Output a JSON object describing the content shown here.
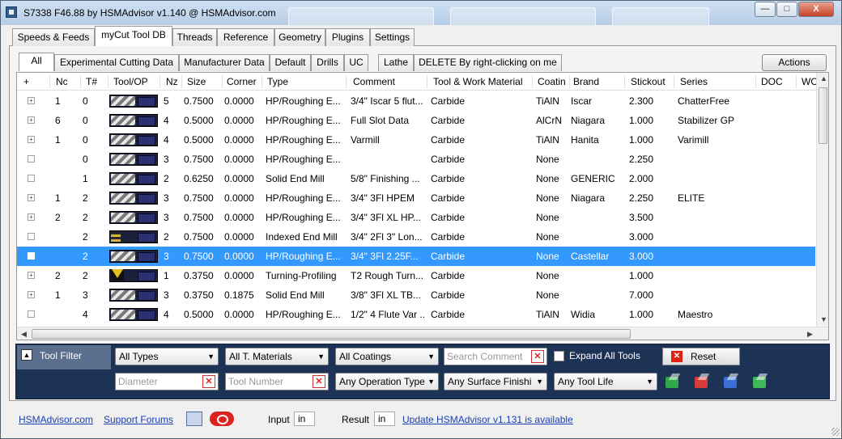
{
  "window": {
    "title": "S7338 F46.88 by HSMAdvisor v1.140 @ HSMAdvisor.com",
    "buttons": {
      "minimize": "—",
      "maximize": "□",
      "close": "X"
    }
  },
  "main_tabs": [
    "Speeds & Feeds",
    "myCut Tool DB",
    "Threads",
    "Reference",
    "Geometry",
    "Plugins",
    "Settings"
  ],
  "active_main_tab": "myCut Tool DB",
  "sub_tabs": [
    "All",
    "Experimental Cutting Data",
    "Manufacturer Data",
    "Default",
    "Drills",
    "UC",
    "Lathe",
    "DELETE By right-clicking on me"
  ],
  "active_sub_tab": "All",
  "actions_label": "Actions",
  "table": {
    "columns": [
      "+",
      "Nc",
      "T#",
      "Tool/OP",
      "Nz",
      "Size",
      "Corner",
      "Type",
      "Comment",
      "Tool & Work Material",
      "Coatin",
      "Brand",
      "Stickout",
      "Series",
      "DOC",
      "WO"
    ],
    "rows": [
      {
        "expander": "+",
        "nc": "1",
        "tn": "0",
        "pic": "mill",
        "nz": "5",
        "size": "0.7500",
        "corner": "0.0000",
        "type": "HP/Roughing E...",
        "comment": "3/4\" Iscar 5 flut...",
        "material": "Carbide",
        "coating": "TiAlN",
        "brand": "Iscar",
        "stickout": "2.300",
        "series": "ChatterFree"
      },
      {
        "expander": "+",
        "nc": "6",
        "tn": "0",
        "pic": "mill",
        "nz": "4",
        "size": "0.5000",
        "corner": "0.0000",
        "type": "HP/Roughing E...",
        "comment": "Full Slot Data",
        "material": "Carbide",
        "coating": "AlCrN",
        "brand": "Niagara",
        "stickout": "1.000",
        "series": "Stabilizer GP"
      },
      {
        "expander": "+",
        "nc": "1",
        "tn": "0",
        "pic": "mill",
        "nz": "4",
        "size": "0.5000",
        "corner": "0.0000",
        "type": "HP/Roughing E...",
        "comment": "Varmill",
        "material": "Carbide",
        "coating": "TiAlN",
        "brand": "Hanita",
        "stickout": "1.000",
        "series": "Varimill"
      },
      {
        "expander": "",
        "nc": "",
        "tn": "0",
        "pic": "mill",
        "nz": "3",
        "size": "0.7500",
        "corner": "0.0000",
        "type": "HP/Roughing E...",
        "comment": "",
        "material": "Carbide",
        "coating": "None",
        "brand": "",
        "stickout": "2.250",
        "series": ""
      },
      {
        "expander": "",
        "nc": "",
        "tn": "1",
        "pic": "mill",
        "nz": "2",
        "size": "0.6250",
        "corner": "0.0000",
        "type": "Solid End Mill",
        "comment": "5/8\" Finishing ...",
        "material": "Carbide",
        "coating": "None",
        "brand": "GENERIC",
        "stickout": "2.000",
        "series": ""
      },
      {
        "expander": "+",
        "nc": "1",
        "tn": "2",
        "pic": "mill",
        "nz": "3",
        "size": "0.7500",
        "corner": "0.0000",
        "type": "HP/Roughing E...",
        "comment": "3/4\" 3Fl  HPEM",
        "material": "Carbide",
        "coating": "None",
        "brand": "Niagara",
        "stickout": "2.250",
        "series": "ELITE"
      },
      {
        "expander": "+",
        "nc": "2",
        "tn": "2",
        "pic": "mill",
        "nz": "3",
        "size": "0.7500",
        "corner": "0.0000",
        "type": "HP/Roughing E...",
        "comment": "3/4\" 3Fl  XL HP...",
        "material": "Carbide",
        "coating": "None",
        "brand": "",
        "stickout": "3.500",
        "series": ""
      },
      {
        "expander": "",
        "nc": "",
        "tn": "2",
        "pic": "insert",
        "nz": "2",
        "size": "0.7500",
        "corner": "0.0000",
        "type": "Indexed End Mill",
        "comment": "3/4\" 2Fl  3\" Lon...",
        "material": "Carbide",
        "coating": "None",
        "brand": "",
        "stickout": "3.000",
        "series": ""
      },
      {
        "expander": "",
        "nc": "",
        "tn": "2",
        "pic": "mill",
        "nz": "3",
        "size": "0.7500",
        "corner": "0.0000",
        "type": "HP/Roughing E...",
        "comment": "3/4\" 3Fl  2.25F...",
        "material": "Carbide",
        "coating": "None",
        "brand": "Castellar",
        "stickout": "3.000",
        "series": "",
        "selected": true
      },
      {
        "expander": "+",
        "nc": "2",
        "tn": "2",
        "pic": "turn",
        "nz": "1",
        "size": "0.3750",
        "corner": "0.0000",
        "type": "Turning-Profiling",
        "comment": "T2 Rough Turn...",
        "material": "Carbide",
        "coating": "None",
        "brand": "",
        "stickout": "1.000",
        "series": ""
      },
      {
        "expander": "+",
        "nc": "1",
        "tn": "3",
        "pic": "mill",
        "nz": "3",
        "size": "0.3750",
        "corner": "0.1875",
        "type": "Solid End Mill",
        "comment": "3/8\" 3Fl  XL TB...",
        "material": "Carbide",
        "coating": "None",
        "brand": "",
        "stickout": "7.000",
        "series": ""
      },
      {
        "expander": "",
        "nc": "",
        "tn": "4",
        "pic": "mill",
        "nz": "4",
        "size": "0.5000",
        "corner": "0.0000",
        "type": "HP/Roughing E...",
        "comment": "1/2\" 4 Flute Var ...",
        "material": "Carbide",
        "coating": "TiAlN",
        "brand": "Widia",
        "stickout": "1.000",
        "series": "Maestro"
      }
    ]
  },
  "filter": {
    "title": "Tool Filter",
    "types": "All Types",
    "materials": "All T. Materials",
    "coatings": "All Coatings",
    "search_placeholder": "Search Comment",
    "expand_label": "Expand All Tools",
    "reset_label": "Reset",
    "diameter_placeholder": "Diameter",
    "toolnum_placeholder": "Tool Number",
    "operation": "Any Operation Type",
    "surface": "Any Surface Finishi",
    "toollife": "Any Tool Life"
  },
  "footer": {
    "site_link": "HSMAdvisor.com",
    "forums_link": "Support Forums",
    "input_label": "Input",
    "input_value": "in",
    "result_label": "Result",
    "result_value": "in",
    "update_link": "Update HSMAdvisor v1.131 is available"
  },
  "colors": {
    "selection": "#3399ff",
    "filter_bg": "#1d3355",
    "link": "#1a3fb0"
  }
}
